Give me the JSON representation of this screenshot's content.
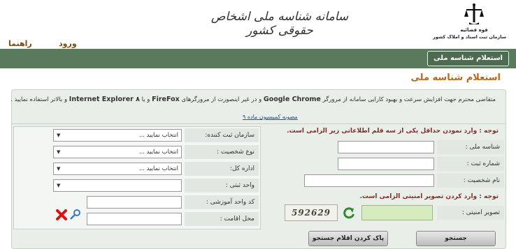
{
  "header": {
    "org_short": "قوه قضائیه",
    "org_name": "سازمان ثبت اسناد و املاک کشور",
    "site_title": "سامانه شناسه ملی اشخاص حقوقی کشور",
    "links": {
      "login": "ورود",
      "help": "راهنما"
    }
  },
  "nav": {
    "active_tab": "استعلام شناسه ملی"
  },
  "page": {
    "title": "استعلام شناسه ملی"
  },
  "notice": {
    "text_start": "متقاضی محترم جهت افزایش سرعت و بهبود کارایی سامانه از مرورگر",
    "chrome": "Google Chrome",
    "text_mid": "و در غیر اینصورت از مرورگرهای",
    "firefox": "FireFox",
    "text_or": "و یا",
    "ie": "Internet Explorer ۸",
    "text_end": "و بالاتر استفاده نمایید .",
    "law_link": "مصوبه کمیسیون ماده ۹"
  },
  "right_form": {
    "requirement_1": "توجه : وارد نمودن حداقل یکی از سه قلم اطلاعاتی زیر الزامی است.",
    "national_id_label": "شناسه ملی :",
    "reg_no_label": "شماره ثبت :",
    "entity_name_label": "نام شخصیت :",
    "requirement_2": "توجه : وارد کردن تصویر امنیتی الزامی است.",
    "captcha_label": "تصویر امنیتی :",
    "captcha_text": "592629"
  },
  "left_form": {
    "registrar_label": "سازمان ثبت کننده:",
    "registrar_value": "انتخاب نمایید ...",
    "entity_type_label": "نوع شخصیت :",
    "entity_type_value": "انتخاب نمایید ...",
    "general_office_label": "اداره کل:",
    "general_office_value": "انتخاب نمایید ...",
    "reg_unit_label": "واحد ثبتی :",
    "reg_unit_value": "",
    "edu_unit_label": "کد واحد آموزشی :",
    "residence_label": "محل اقامت :"
  },
  "buttons": {
    "search": "جستجو",
    "clear": "پاک کردن اقلام جستجو"
  },
  "colors": {
    "nav_bg": "#5a7a5e",
    "title_accent": "#b46a1a",
    "captcha_input_bg": "#d6ecbe"
  }
}
